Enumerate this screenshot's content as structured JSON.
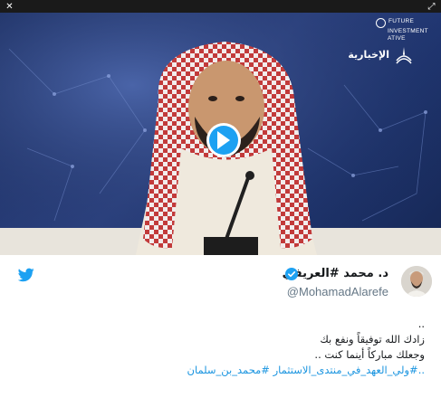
{
  "window": {
    "close_glyph": "✕",
    "expand_glyph": "⤢"
  },
  "video": {
    "event_logo": "FUTURE INVESTMENT INITIATIVE",
    "event_logo_lines": [
      "FUTURE",
      "INVESTMENT",
      "ATIVE"
    ],
    "channel_name": "الإخبارية",
    "play_icon": "play-icon"
  },
  "tweet": {
    "display_name": "د. محمد #العريفي",
    "handle": "@MohamadAlarefe",
    "verified": true,
    "lines": [
      "..",
      "زادك الله توفيقاً ونفع بك",
      "وجعلك مباركاً أينما كنت ..",
      "..#ولي_العهد_في_منتدى_الاستثمار #محمد_بن_سلمان"
    ],
    "colors": {
      "twitter_blue": "#1da1f2",
      "link": "#1b95e0",
      "text": "#14171a",
      "muted": "#657786"
    }
  }
}
